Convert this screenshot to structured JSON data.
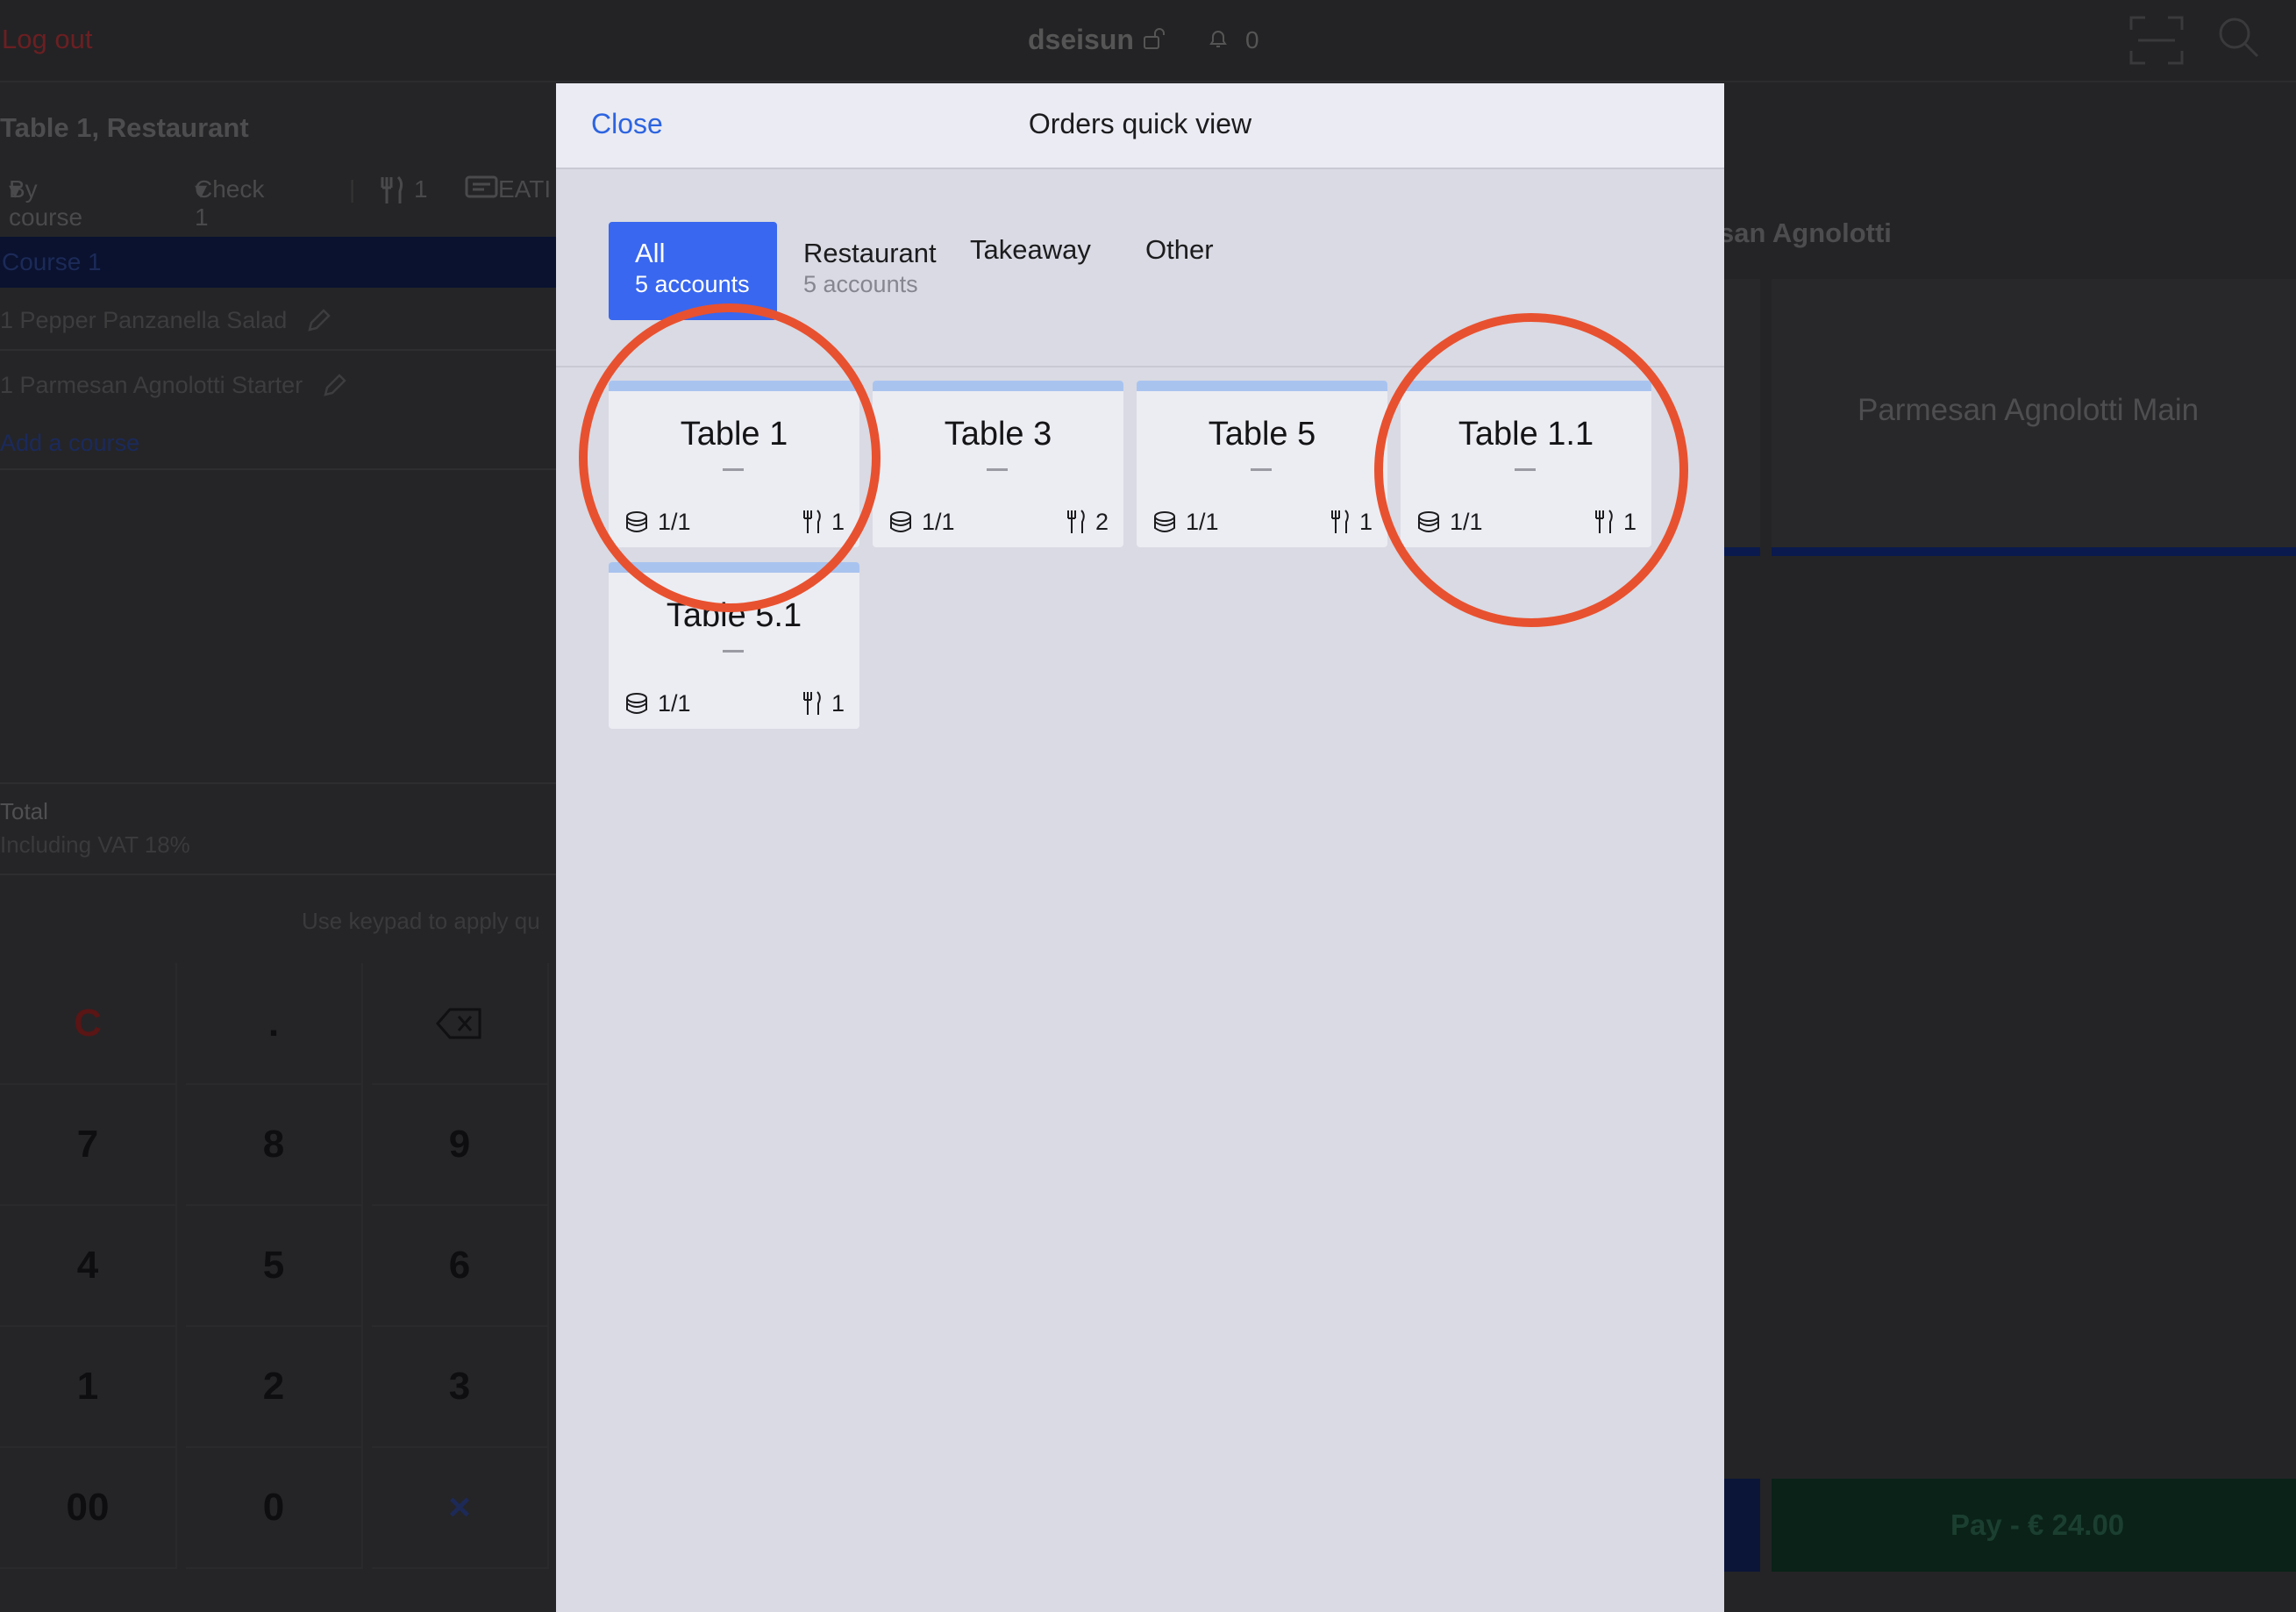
{
  "topbar": {
    "logout": "Log out",
    "user": "dseisun",
    "notification_count": "0"
  },
  "order": {
    "title": "Table 1, Restaurant",
    "view_mode": "By course",
    "check": "Check 1",
    "guests": "1",
    "eat_label": "EATI",
    "course": "Course 1",
    "items": [
      "1  Pepper Panzanella Salad",
      "1  Parmesan Agnolotti Starter"
    ],
    "add_course": "Add a course",
    "total_label": "Total",
    "vat_label": "Including VAT 18%",
    "keypad_hint": "Use keypad to apply qu"
  },
  "keypad": {
    "row1": [
      "C",
      ".",
      ""
    ],
    "row2": [
      "7",
      "8",
      "9"
    ],
    "row3": [
      "4",
      "5",
      "6"
    ],
    "row4": [
      "1",
      "2",
      "3"
    ],
    "row5": [
      "00",
      "0",
      "×"
    ]
  },
  "right": {
    "title": "san Agnolotti",
    "product_main": "Parmesan Agnolotti Main",
    "pay_button": "Pay - € 24.00"
  },
  "modal": {
    "close": "Close",
    "title": "Orders quick view",
    "tabs": [
      {
        "label": "All",
        "sub": "5 accounts",
        "active": true
      },
      {
        "label": "Restaurant",
        "sub": "5 accounts"
      },
      {
        "label": "Takeaway",
        "sub": ""
      },
      {
        "label": "Other",
        "sub": ""
      }
    ],
    "tables": [
      {
        "name": "Table 1",
        "paid": "1/1",
        "guests": "1"
      },
      {
        "name": "Table 3",
        "paid": "1/1",
        "guests": "2"
      },
      {
        "name": "Table 5",
        "paid": "1/1",
        "guests": "1"
      },
      {
        "name": "Table 1.1",
        "paid": "1/1",
        "guests": "1"
      },
      {
        "name": "Table 5.1",
        "paid": "1/1",
        "guests": "1"
      }
    ]
  },
  "colors": {
    "accent": "#3967ef",
    "link": "#2d64e0",
    "annotation": "#e8512f",
    "card_bar": "#a9c3ef"
  }
}
